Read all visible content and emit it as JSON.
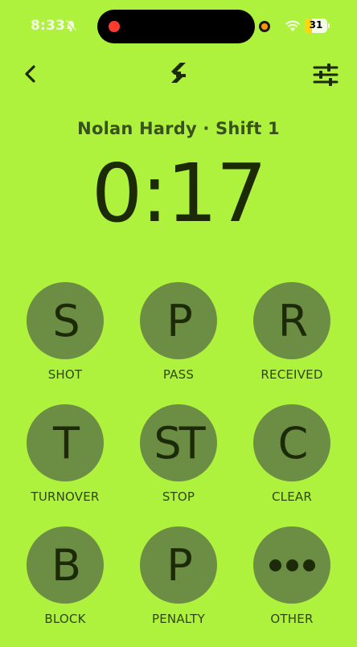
{
  "status_bar": {
    "time": "8:33",
    "battery": "31",
    "battery_level": 0.31
  },
  "header": {
    "player_title": "Nolan Hardy · Shift 1",
    "timer": "0:17"
  },
  "icons": {
    "back": "chevron-left-icon",
    "logo": "bolt-logo",
    "filter": "sliders-icon"
  },
  "actions": [
    {
      "symbol": "S",
      "label": "SHOT"
    },
    {
      "symbol": "P",
      "label": "PASS"
    },
    {
      "symbol": "R",
      "label": "RECEIVED"
    },
    {
      "symbol": "T",
      "label": "TURNOVER"
    },
    {
      "symbol": "ST",
      "label": "STOP"
    },
    {
      "symbol": "C",
      "label": "CLEAR"
    },
    {
      "symbol": "B",
      "label": "BLOCK"
    },
    {
      "symbol": "P",
      "label": "PENALTY"
    },
    {
      "symbol": "",
      "label": "OTHER"
    }
  ],
  "colors": {
    "background": "#aef23e",
    "button_fill": "#6c8e44",
    "text_dark": "#1c2a07"
  }
}
